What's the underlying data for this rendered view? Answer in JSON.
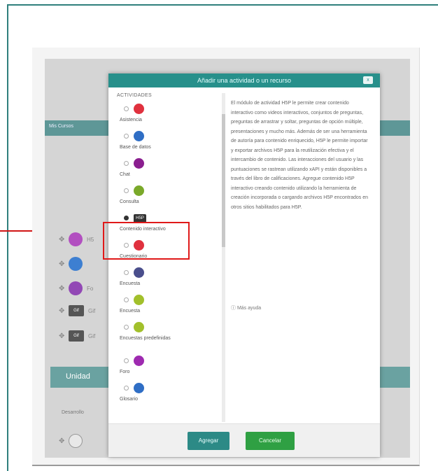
{
  "background_page": {
    "breadcrumb": "Mis Cursos",
    "unit_heading": "Unidad",
    "unit_sub": "Desarrollo",
    "rows": [
      {
        "icon": "h5p-icon",
        "label": "H5",
        "color": "#b24fc0"
      },
      {
        "icon": "circle-icon",
        "label": "",
        "color": "#3d7fd1"
      },
      {
        "icon": "circle-icon",
        "label": "Fo",
        "color": "#9248b5"
      },
      {
        "icon": "gif-icon",
        "label": "Gif",
        "color": ""
      },
      {
        "icon": "gif-icon",
        "label": "Gif",
        "color": ""
      }
    ]
  },
  "modal": {
    "title": "Añadir una actividad o un recurso",
    "close_label": "x",
    "list_caption": "ACTIVIDADES",
    "items": [
      {
        "label": "Asistencia",
        "color": "#e0313e",
        "selected": false
      },
      {
        "label": "Base de datos",
        "color": "#2f6ec5",
        "selected": false
      },
      {
        "label": "Chat",
        "color": "#8a1e8f",
        "selected": false
      },
      {
        "label": "Consulta",
        "color": "#7aa92a",
        "selected": false
      },
      {
        "label": "Contenido interactivo",
        "icon_text": "H5P",
        "selected": true
      },
      {
        "label": "Cuestionario",
        "color": "#e0313e",
        "selected": false
      },
      {
        "label": "Encuesta",
        "color": "#4a4e8c",
        "selected": false
      },
      {
        "label": "Encuesta",
        "color": "#a2c02b",
        "selected": false
      },
      {
        "label": "Encuestas predefinidas",
        "color": "#a2c02b",
        "selected": false
      },
      {
        "label": "Foro",
        "color": "#9e2ab0",
        "selected": false
      },
      {
        "label": "Glosario",
        "color": "#2f6ec5",
        "selected": false
      }
    ],
    "description": "El módulo de actividad H5P le permite crear contenido interactivo como videos interactivos, conjuntos de preguntas, preguntas de arrastrar y soltar, preguntas de opción múltiple, presentaciones y mucho más. Además de ser una herramienta de autoría para contenido enriquecido, H5P le permite importar y exportar archivos H5P para la reutilización efectiva y el intercambio de contenido. Las interacciones del usuario y las puntuaciones se rastrean utilizando xAPI y están disponibles a través del libro de calificaciones. Agregue contenido H5P interactivo creando contenido utilizando la herramienta de creación incorporada o cargando archivos H5P encontrados en otros sitios habilitados para H5P.",
    "more_help": "Más ayuda",
    "add_button": "Agregar",
    "cancel_button": "Cancelar"
  },
  "annotation": {
    "highlight_color": "#e01919",
    "arrow_color": "#d11515"
  }
}
